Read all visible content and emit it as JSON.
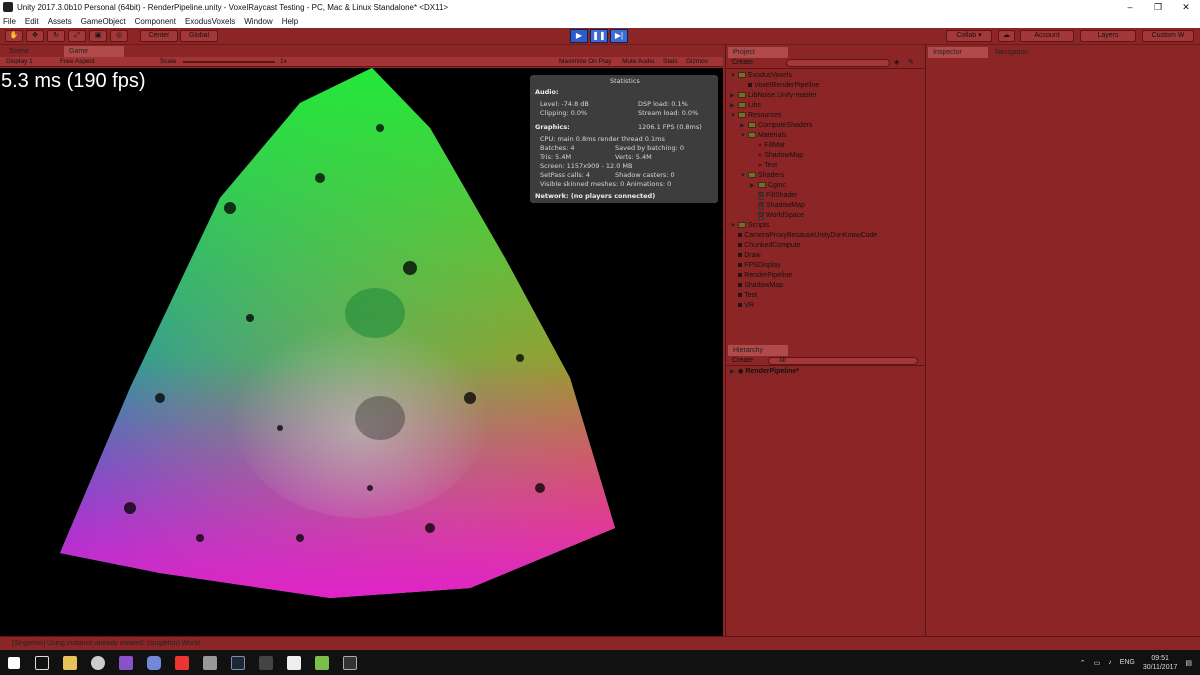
{
  "window": {
    "title": "Unity 2017.3.0b10 Personal (64bit) - RenderPipeline.unity - VoxelRaycast Testing - PC, Mac & Linux Standalone* <DX11>",
    "controls": [
      "–",
      "❐",
      "✕"
    ]
  },
  "menu": [
    "File",
    "Edit",
    "Assets",
    "GameObject",
    "Component",
    "ExodusVoxels",
    "Window",
    "Help"
  ],
  "toolbar": {
    "center": "Center",
    "global": "Global",
    "collab": "Collab ▾",
    "account": "Account",
    "layers": "Layers",
    "layout": "Custom W"
  },
  "tabs": {
    "scene": "Scene",
    "game": "Game"
  },
  "game_toolbar": {
    "display": "Display 1",
    "aspect": "Free Aspect",
    "scale_label": "Scale",
    "scale_value": "1x",
    "maximize": "Maximize On Play",
    "mute": "Mute Audio",
    "stats": "Stats",
    "gizmos": "Gizmos"
  },
  "viewport": {
    "fps_text": "5.3 ms (190 fps)"
  },
  "stats": {
    "title": "Statistics",
    "audio_header": "Audio:",
    "level": "Level: -74.8 dB",
    "dsp": "DSP load: 0.1%",
    "clipping": "Clipping: 0.0%",
    "stream": "Stream load: 0.0%",
    "graphics_header": "Graphics:",
    "fps": "1206.1 FPS (0.8ms)",
    "cpu": "CPU: main 0.8ms  render thread 0.1ms",
    "batches": "Batches: 4",
    "saved": "Saved by batching: 0",
    "tris": "Tris: 5.4M",
    "verts": "Verts: 5.4M",
    "screen": "Screen: 1157x909 - 12.0 MB",
    "setpass": "SetPass calls: 4",
    "shadow": "Shadow casters: 0",
    "skinned": "Visible skinned meshes: 0  Animations: 0",
    "network": "Network: (no players connected)"
  },
  "project": {
    "tab": "Project",
    "create": "Create",
    "items": [
      {
        "label": "ExodusVoxels",
        "indent": 0,
        "kind": "folder",
        "open": true
      },
      {
        "label": "VoxelRenderPipeline",
        "indent": 1,
        "kind": "file"
      },
      {
        "label": "LibNoise.Unity-master",
        "indent": 0,
        "kind": "folder"
      },
      {
        "label": "Libs",
        "indent": 0,
        "kind": "folder"
      },
      {
        "label": "Resources",
        "indent": 0,
        "kind": "folder",
        "open": true
      },
      {
        "label": "ComputeShaders",
        "indent": 1,
        "kind": "folder"
      },
      {
        "label": "Materials",
        "indent": 1,
        "kind": "folder",
        "open": true
      },
      {
        "label": "FillMat",
        "indent": 2,
        "kind": "material"
      },
      {
        "label": "ShadowMap",
        "indent": 2,
        "kind": "material"
      },
      {
        "label": "Test",
        "indent": 2,
        "kind": "material"
      },
      {
        "label": "Shaders",
        "indent": 1,
        "kind": "folder",
        "open": true
      },
      {
        "label": "Cginc",
        "indent": 2,
        "kind": "folder"
      },
      {
        "label": "FillShader",
        "indent": 2,
        "kind": "shader"
      },
      {
        "label": "ShadowMap",
        "indent": 2,
        "kind": "shader"
      },
      {
        "label": "WorldSpace",
        "indent": 2,
        "kind": "shader"
      },
      {
        "label": "Scripts",
        "indent": 0,
        "kind": "folder",
        "open": true
      },
      {
        "label": "CameraProxyBecauseUnityDunKnowCode",
        "indent": 0,
        "kind": "script"
      },
      {
        "label": "ChunkedCompute",
        "indent": 0,
        "kind": "script"
      },
      {
        "label": "Draw",
        "indent": 0,
        "kind": "script"
      },
      {
        "label": "FPSDisplay",
        "indent": 0,
        "kind": "script"
      },
      {
        "label": "RenderPipeline",
        "indent": 0,
        "kind": "script"
      },
      {
        "label": "ShadowMap",
        "indent": 0,
        "kind": "script"
      },
      {
        "label": "Test",
        "indent": 0,
        "kind": "script"
      },
      {
        "label": "VR",
        "indent": 0,
        "kind": "script"
      }
    ]
  },
  "hierarchy": {
    "tab": "Hierarchy",
    "create": "Create",
    "search": "All",
    "scene": "RenderPipeline*"
  },
  "inspector": {
    "tab": "Inspector",
    "nav_tab": "Navigation"
  },
  "console": {
    "message": "[Singleton] Using instance already created: (singleton) World"
  },
  "taskbar": {
    "lang": "ENG",
    "time": "09:51",
    "date": "30/11/2017"
  },
  "colors": {
    "panel": "#8c2626",
    "viewport": "#000000",
    "accent": "#3e6bd3"
  }
}
